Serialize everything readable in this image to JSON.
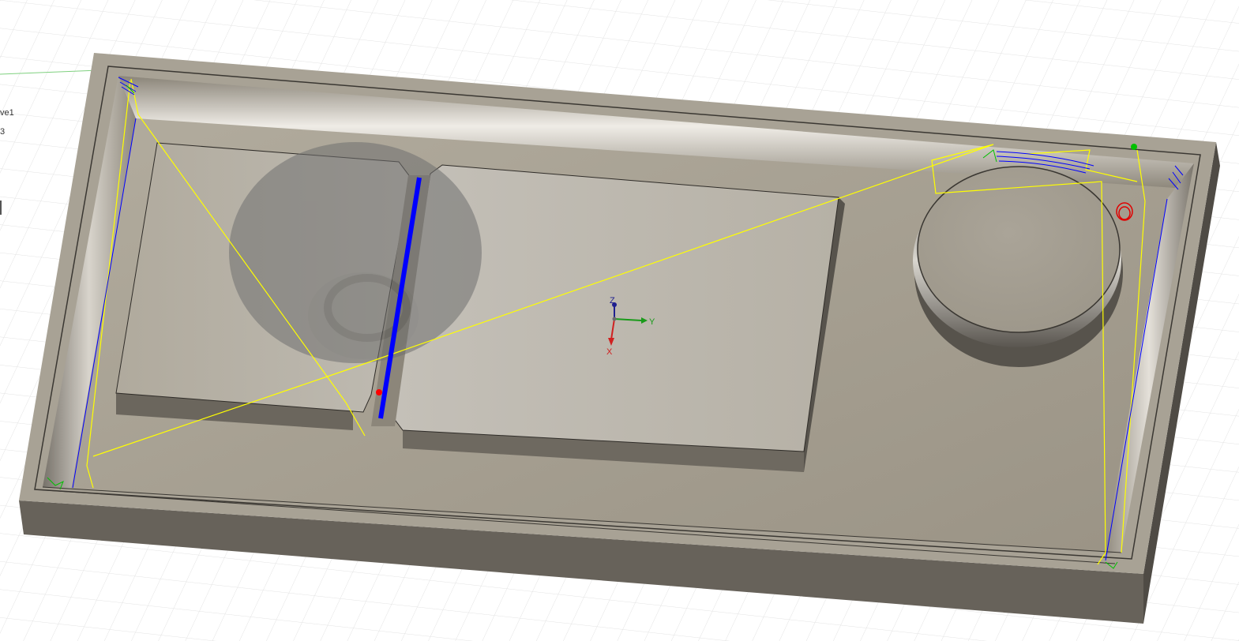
{
  "browser_fragments": {
    "item_1": "ve1",
    "item_2": "3"
  },
  "view_triad": {
    "z_label": "Z",
    "y_label": "Y",
    "x_label": "X"
  },
  "colors": {
    "grid": "#e2e2e2",
    "part": "#a59e91",
    "part_light": "#bcb6ab",
    "part_dark": "#4f4b45",
    "rapid_path": "#ffff00",
    "cutting_path": "#0000ff",
    "lead_path": "#00c000",
    "plunge_path": "#ff0000"
  }
}
